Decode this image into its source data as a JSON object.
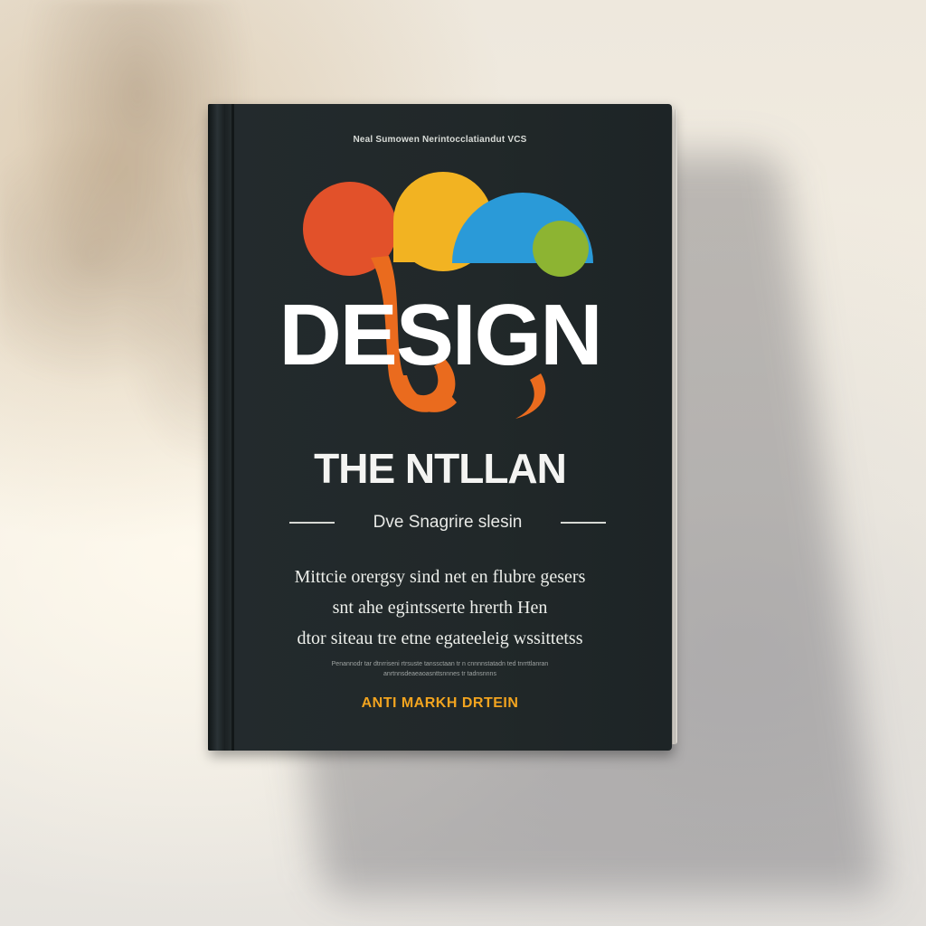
{
  "cover": {
    "top_line": "Neal Sumowen Nerintocclatiandut VCS",
    "title": "DESIGN",
    "subtitle": "THE NTLLAN",
    "tagline": "Dve Snagrire slesin",
    "description_lines": [
      "Mittcie orergsy sind net en flubre gesers",
      "snt ahe egintsserte hrerth Hen",
      "dtor siteau tre etne egateeleig wssittetss"
    ],
    "fine_print_lines": [
      "Penannodr tar dtnrriseni rtrsuste tanssctaan tr n cnnnnstatadn ted tnrrttlanran",
      "anrtnnsdeaeaoasnttsnnnes tr tadnsnnns"
    ],
    "author": "ANTI MARKH DRTEIN"
  },
  "colors": {
    "cover": "#212829",
    "orange_red": "#e2512a",
    "yellow": "#f2b322",
    "blue": "#2a9ad8",
    "green": "#8db432",
    "orange": "#ea6b1e",
    "author_text": "#f2a41f"
  }
}
